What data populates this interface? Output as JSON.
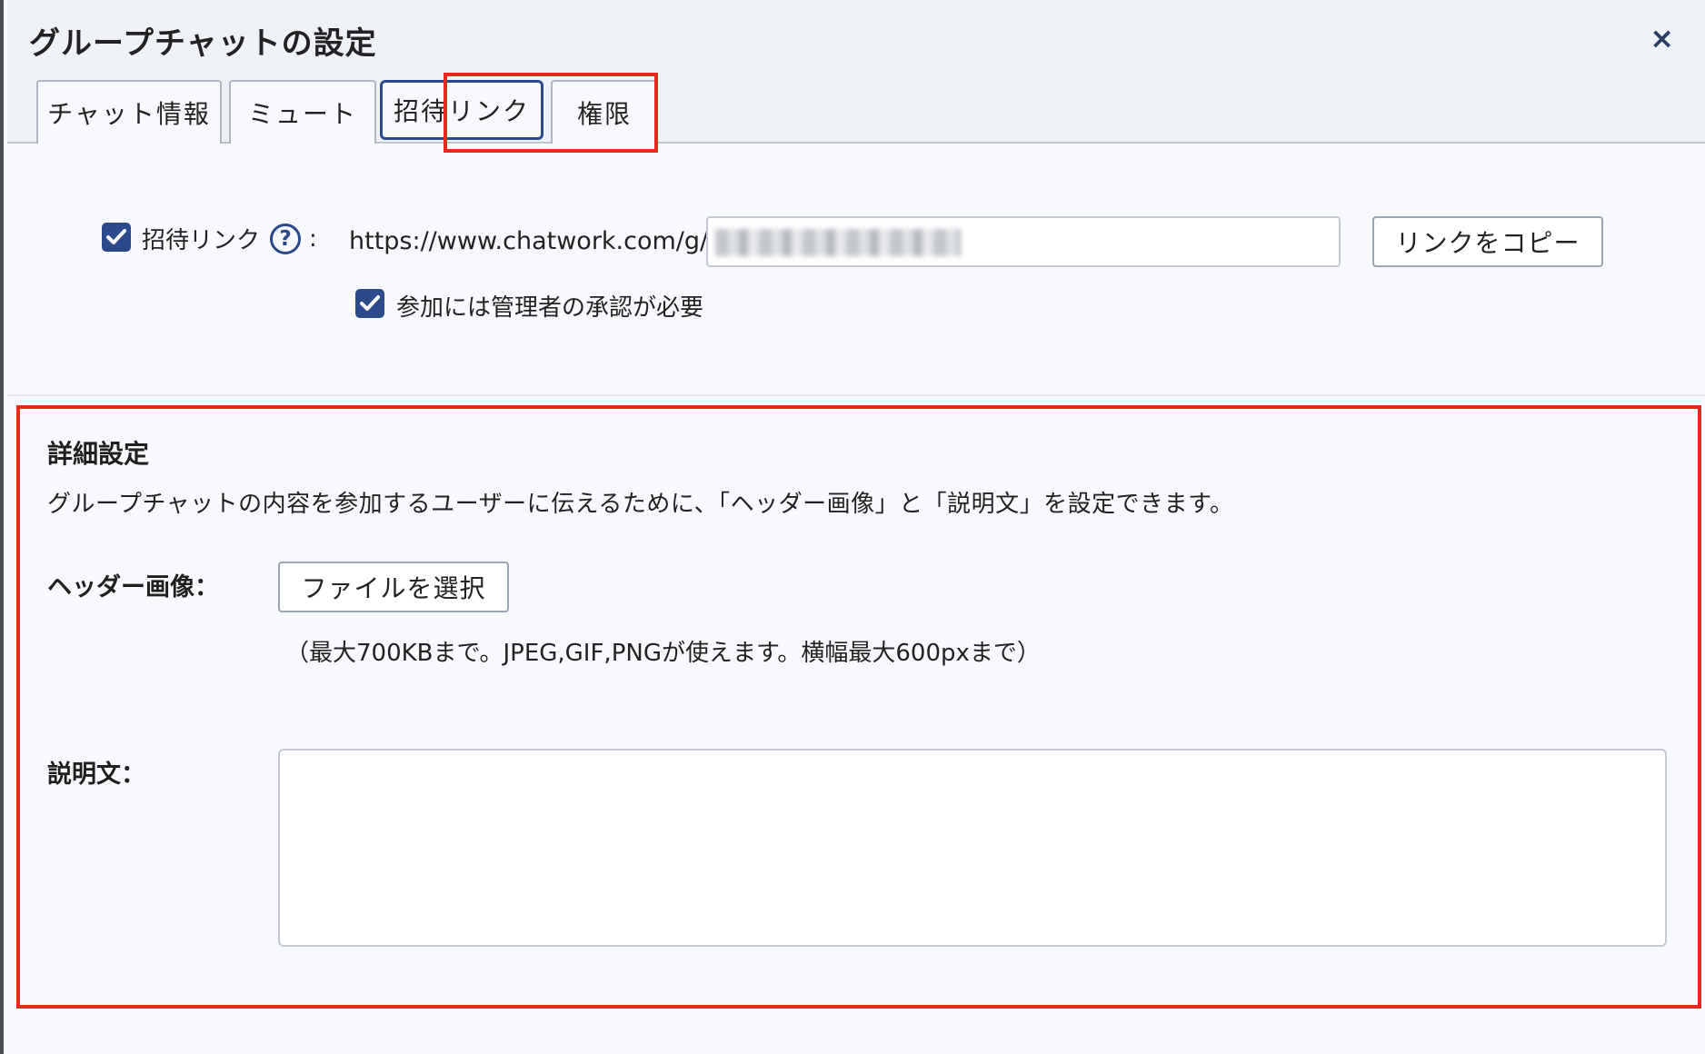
{
  "dialog": {
    "title": "グループチャットの設定",
    "close_label": "×"
  },
  "tabs": [
    {
      "label": "チャット情報",
      "active": false
    },
    {
      "label": "ミュート",
      "active": false
    },
    {
      "label": "招待リンク",
      "active": true
    },
    {
      "label": "権限",
      "active": false
    }
  ],
  "invite": {
    "enabled": true,
    "label": "招待リンク",
    "help_icon": "question-circle-icon",
    "colon": ":",
    "url_prefix": "https://www.chatwork.com/g/",
    "copy_button": "リンクをコピー",
    "approval_label": "参加には管理者の承認が必要",
    "approval_checked": true
  },
  "advanced": {
    "title": "詳細設定",
    "description": "グループチャットの内容を参加するユーザーに伝えるために、「ヘッダー画像」と「説明文」を設定できます。",
    "header_image_label": "ヘッダー画像：",
    "file_button": "ファイルを選択",
    "file_note": "（最大700KBまで。JPEG,GIF,PNGが使えます。横幅最大600pxまで）",
    "description_label": "説明文：",
    "description_value": ""
  },
  "colors": {
    "accent": "#2b4a8b",
    "highlight": "#e8281a"
  }
}
